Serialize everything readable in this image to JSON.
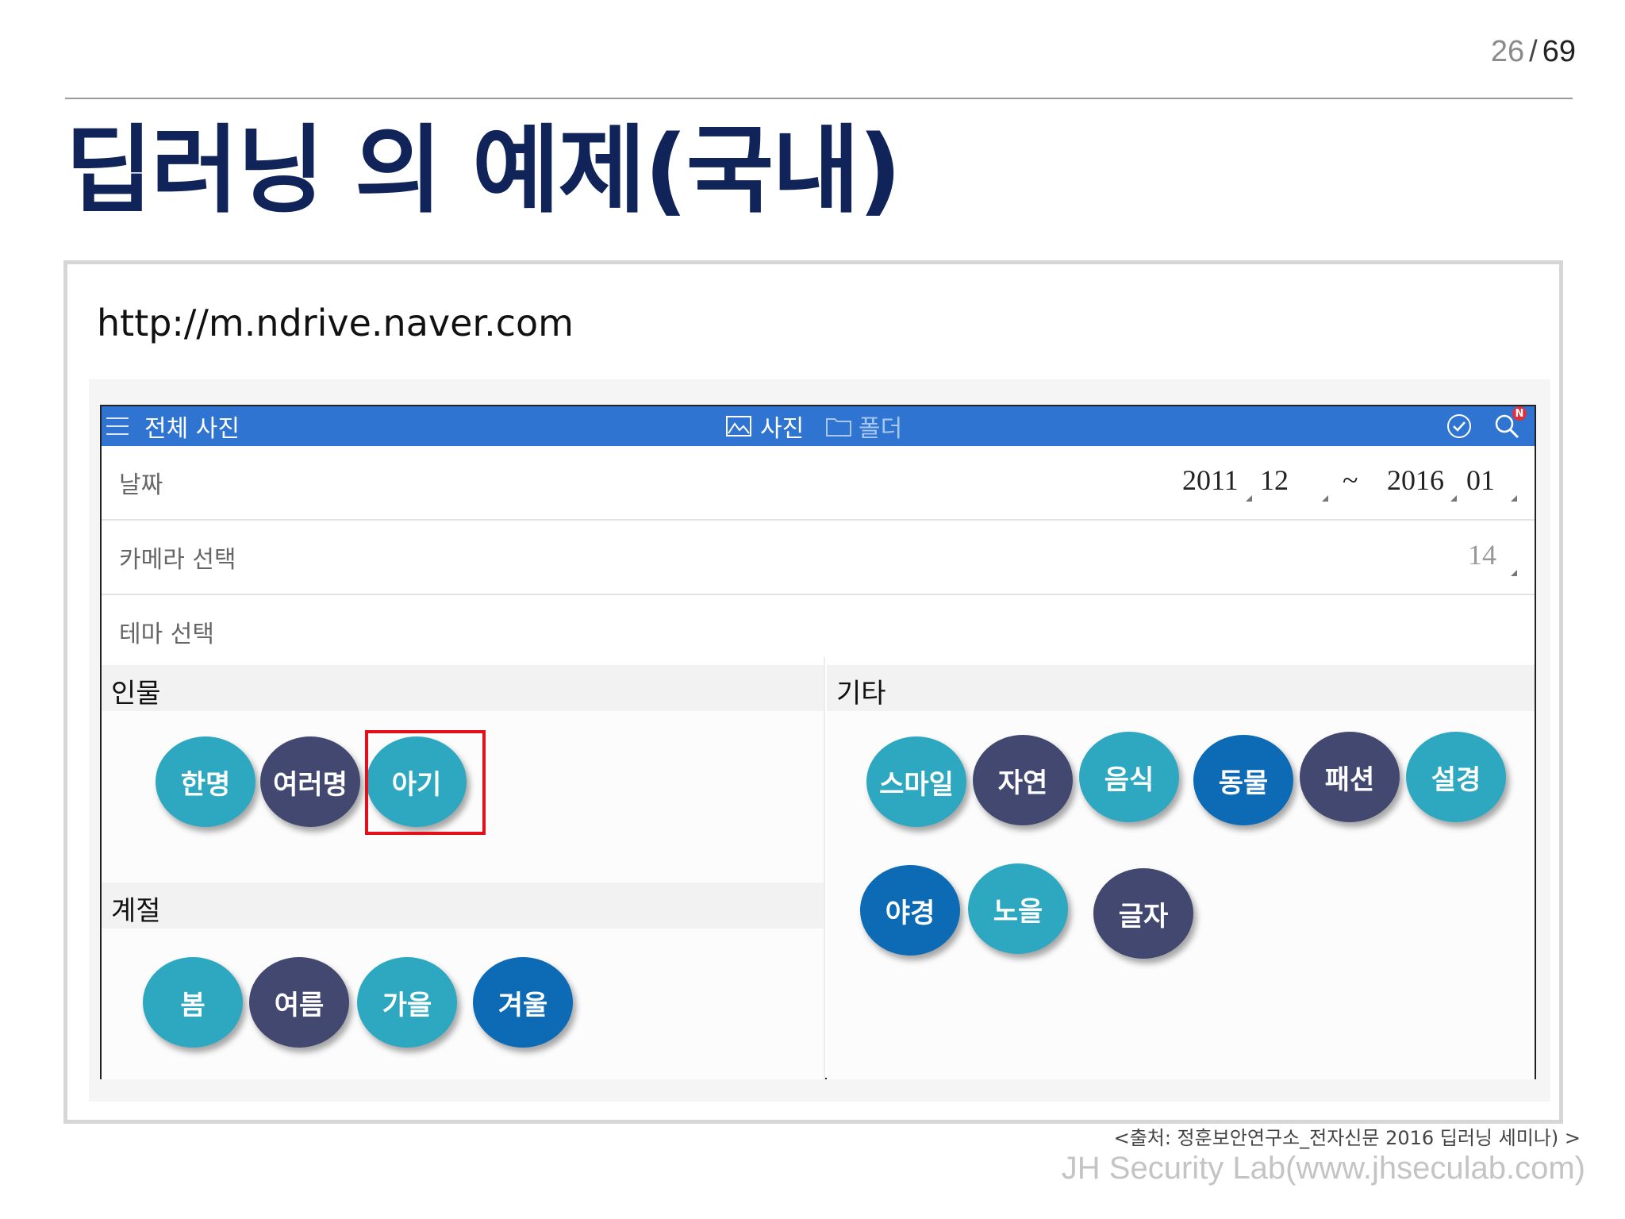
{
  "page": {
    "current": "26",
    "separator": "/",
    "total": "69"
  },
  "title": "딥러닝 의 예제(국내)",
  "url": "http://m.ndrive.naver.com",
  "app": {
    "topbar": {
      "page_label": "전체 사진",
      "tabs": [
        {
          "label": "사진"
        },
        {
          "label": "폴더"
        }
      ],
      "badge": "N",
      "color": "#2f74d0"
    },
    "filters": {
      "date": {
        "label": "날짜",
        "from_year": "2011",
        "from_month": "12",
        "range_sep": "~",
        "to_year": "2016",
        "to_month": "01"
      },
      "camera": {
        "label": "카메라 선택",
        "value": "14"
      },
      "theme": {
        "label": "테마 선택"
      }
    },
    "sections": {
      "people": {
        "label": "인물",
        "chips": [
          "한명",
          "여러명",
          "아기"
        ]
      },
      "season": {
        "label": "계절",
        "chips": [
          "봄",
          "여름",
          "가을",
          "겨울"
        ]
      },
      "other": {
        "label": "기타",
        "chips": [
          "스마일",
          "자연",
          "음식",
          "동물",
          "패션",
          "설경",
          "야경",
          "노을",
          "글자"
        ]
      }
    },
    "selected_chip": "아기",
    "chip_colors": {
      "teal": "#2ea8c1",
      "navy": "#434870",
      "blue": "#0d6ab5"
    },
    "highlight_color": "#e3101b"
  },
  "source": "<출처: 정훈보안연구소_전자신문 2016 딥러닝 세미나) >",
  "watermark": "JH Security Lab(www.jhseculab.com)"
}
